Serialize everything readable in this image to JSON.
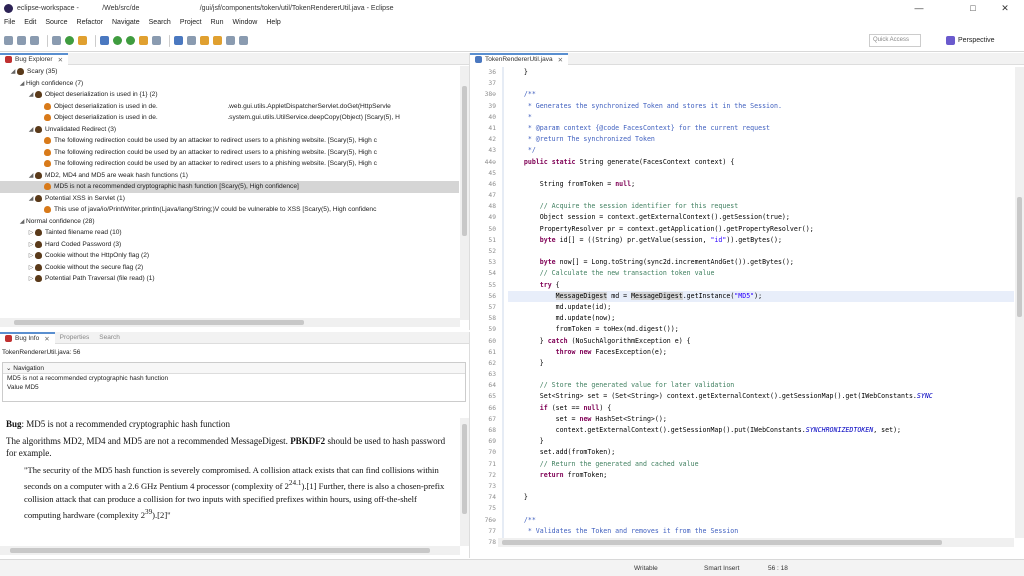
{
  "window": {
    "title": "eclipse-workspace -            /Web/src/de                               /gui/jsf/components/token/util/TokenRendererUtil.java - Eclipse",
    "minimize": "—",
    "maximize": "□",
    "close": "✕"
  },
  "menubar": [
    "File",
    "Edit",
    "Source",
    "Refactor",
    "Navigate",
    "Search",
    "Project",
    "Run",
    "Window",
    "Help"
  ],
  "toolbar": {
    "quick_access": "Quick Access",
    "perspective": "Perspective"
  },
  "bug_explorer": {
    "tab_label": "Bug Explorer",
    "rows": [
      {
        "indent": 1,
        "arrow": "◢",
        "icon": "bug",
        "text": "Scary (35)"
      },
      {
        "indent": 2,
        "arrow": "◢",
        "icon": "",
        "text": "High confidence (7)"
      },
      {
        "indent": 3,
        "arrow": "◢",
        "icon": "bug",
        "text": "Object deserialization is used in {1} (2)"
      },
      {
        "indent": 4,
        "arrow": "",
        "icon": "bugo",
        "text": "Object deserialization is used in de.                                      .web.gui.utils.AppletDispatcherServlet.doGet(HttpServle"
      },
      {
        "indent": 4,
        "arrow": "",
        "icon": "bugo",
        "text": "Object deserialization is used in de.                                      .system.gui.utils.UtilService.deepCopy(Object) [Scary(5), H"
      },
      {
        "indent": 3,
        "arrow": "◢",
        "icon": "bug",
        "text": "Unvalidated Redirect (3)"
      },
      {
        "indent": 4,
        "arrow": "",
        "icon": "bugo",
        "text": "The following redirection could be used by an attacker to redirect users to a phishing website. [Scary(5), High c"
      },
      {
        "indent": 4,
        "arrow": "",
        "icon": "bugo",
        "text": "The following redirection could be used by an attacker to redirect users to a phishing website. [Scary(5), High c"
      },
      {
        "indent": 4,
        "arrow": "",
        "icon": "bugo",
        "text": "The following redirection could be used by an attacker to redirect users to a phishing website. [Scary(5), High c"
      },
      {
        "indent": 3,
        "arrow": "◢",
        "icon": "bug",
        "text": "MD2, MD4 and MD5 are weak hash functions (1)"
      },
      {
        "indent": 4,
        "arrow": "",
        "icon": "bugo",
        "text": "MD5 is not a recommended cryptographic hash function [Scary(5), High confidence]",
        "selected": true
      },
      {
        "indent": 3,
        "arrow": "◢",
        "icon": "bug",
        "text": "Potential XSS in Servlet (1)"
      },
      {
        "indent": 4,
        "arrow": "",
        "icon": "bugo",
        "text": "This use of java/io/PrintWriter.println(Ljava/lang/String;)V could be vulnerable to XSS [Scary(5), High confidenc"
      },
      {
        "indent": 2,
        "arrow": "◢",
        "icon": "",
        "text": "Normal confidence (28)"
      },
      {
        "indent": 3,
        "arrow": "▷",
        "icon": "bug",
        "text": "Tainted filename read (10)"
      },
      {
        "indent": 3,
        "arrow": "▷",
        "icon": "bug",
        "text": "Hard Coded Password (3)"
      },
      {
        "indent": 3,
        "arrow": "▷",
        "icon": "bug",
        "text": "Cookie without the HttpOnly flag (2)"
      },
      {
        "indent": 3,
        "arrow": "▷",
        "icon": "bug",
        "text": "Cookie without the secure flag (2)"
      },
      {
        "indent": 3,
        "arrow": "▷",
        "icon": "bug",
        "text": "Potential Path Traversal (file read) (1)"
      }
    ]
  },
  "bug_info": {
    "tabs": [
      "Bug Info",
      "Properties",
      "Search"
    ],
    "file": "TokenRendererUtil.java: 56",
    "navigation_label": "Navigation",
    "nav_lines": [
      "MD5 is not a recommended cryptographic hash function",
      "Value MD5"
    ],
    "bug_heading": "Bug",
    "bug_title": ": MD5 is not a recommended cryptographic hash function",
    "para1_a": "The algorithms MD2, MD4 and MD5 are not a recommended MessageDigest. ",
    "para1_b": "PBKDF2",
    "para1_c": " should be used to hash password for example.",
    "quote_a": "\"The security of the MD5 hash function is severely compromised. A collision attack exists that can find collisions within seconds on a computer with a 2.6 GHz Pentium 4 processor (complexity of 2",
    "quote_sup1": "24.1",
    "quote_b": ").[1] Further, there is also a chosen-prefix collision attack that can produce a collision for two inputs with specified prefixes within hours, using off-the-shelf computing hardware (complexity 2",
    "quote_sup2": "39",
    "quote_c": ").[2]\""
  },
  "editor": {
    "tab_label": "TokenRendererUtil.java",
    "line_numbers": [
      "36",
      "37",
      "38⊖",
      "39",
      "40",
      "41",
      "42",
      "43",
      "44⊖",
      "45",
      "46",
      "47",
      "48",
      "49",
      "50",
      "51",
      "52",
      "53",
      "54",
      "55",
      "56",
      "57",
      "58",
      "59",
      "60",
      "61",
      "62",
      "63",
      "64",
      "65",
      "66",
      "67",
      "68",
      "69",
      "70",
      "71",
      "72",
      "73",
      "74",
      "75",
      "76⊖",
      "77",
      "78"
    ],
    "code": [
      "    }",
      "",
      "    /**",
      "     * Generates the synchronized Token and stores it in the Session.",
      "     *",
      "     * @param context {@code FacesContext} for the current request",
      "     * @return The synchronized Token",
      "     */",
      "    public static String generate(FacesContext context) {",
      "",
      "        String fromToken = null;",
      "",
      "        // Acquire the session identifier for this request",
      "        Object session = context.getExternalContext().getSession(true);",
      "        PropertyResolver pr = context.getApplication().getPropertyResolver();",
      "        byte id[] = ((String) pr.getValue(session, \"id\")).getBytes();",
      "",
      "        byte now[] = Long.toString(sync2d.incrementAndGet()).getBytes();",
      "        // Calculate the new transaction token value",
      "        try {",
      "            MessageDigest md = MessageDigest.getInstance(\"MD5\");",
      "            md.update(id);",
      "            md.update(now);",
      "            fromToken = toHex(md.digest());",
      "        } catch (NoSuchAlgorithmException e) {",
      "            throw new FacesException(e);",
      "        }",
      "",
      "        // Store the generated value for later validation",
      "        Set<String> set = (Set<String>) context.getExternalContext().getSessionMap().get(IWebConstants.SYNC",
      "        if (set == null) {",
      "            set = new HashSet<String>();",
      "            context.getExternalContext().getSessionMap().put(IWebConstants.SYNCHRONIZEDTOKEN, set);",
      "        }",
      "        set.add(fromToken);",
      "        // Return the generated and cached value",
      "        return fromToken;",
      "",
      "    }",
      "",
      "    /**",
      "     * Validates the Token and removes it from the Session",
      "     *"
    ]
  },
  "status": {
    "writable": "Writable",
    "insert_mode": "Smart Insert",
    "position": "56 : 18"
  }
}
